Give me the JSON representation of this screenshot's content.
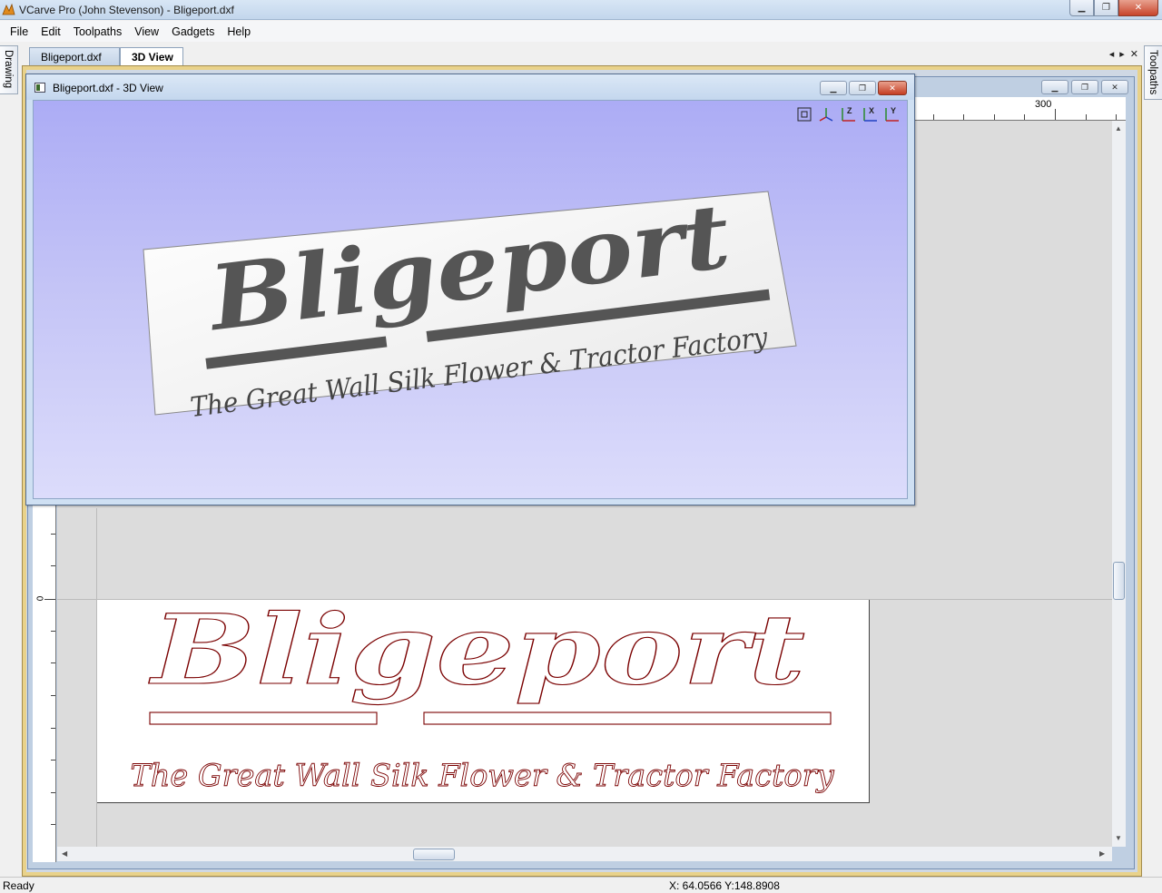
{
  "window": {
    "title": "VCarve Pro (John Stevenson) - Bligeport.dxf",
    "buttons": {
      "minimize": "▁",
      "maximize": "❐",
      "close": "✕"
    }
  },
  "menu": [
    "File",
    "Edit",
    "Toolpaths",
    "View",
    "Gadgets",
    "Help"
  ],
  "side_tabs": {
    "left": "Drawing",
    "right": "Toolpaths"
  },
  "doc_tabs": [
    {
      "label": "Bligeport.dxf",
      "active": false
    },
    {
      "label": "3D View",
      "active": true
    }
  ],
  "tab_controls": [
    "◂",
    "▸",
    "✕"
  ],
  "view3d": {
    "title": "Bligeport.dxf - 3D View",
    "tool_icons": [
      "zoom-extents-icon",
      "iso-view-icon",
      "z-view-icon",
      "x-view-icon",
      "y-view-icon"
    ],
    "tool_labels": [
      "Z",
      "X",
      "Y"
    ],
    "background_top": "#acacf5",
    "background_bottom": "#dcdcfb"
  },
  "design": {
    "logo_text": "Bligeport",
    "tagline": "The Great Wall Silk Flower & Tractor Factory",
    "vector_color": "#7a0000"
  },
  "ruler": {
    "top_label": "300",
    "left_label": "0"
  },
  "status": {
    "ready": "Ready",
    "coords": "X: 64.0566 Y:148.8908"
  }
}
